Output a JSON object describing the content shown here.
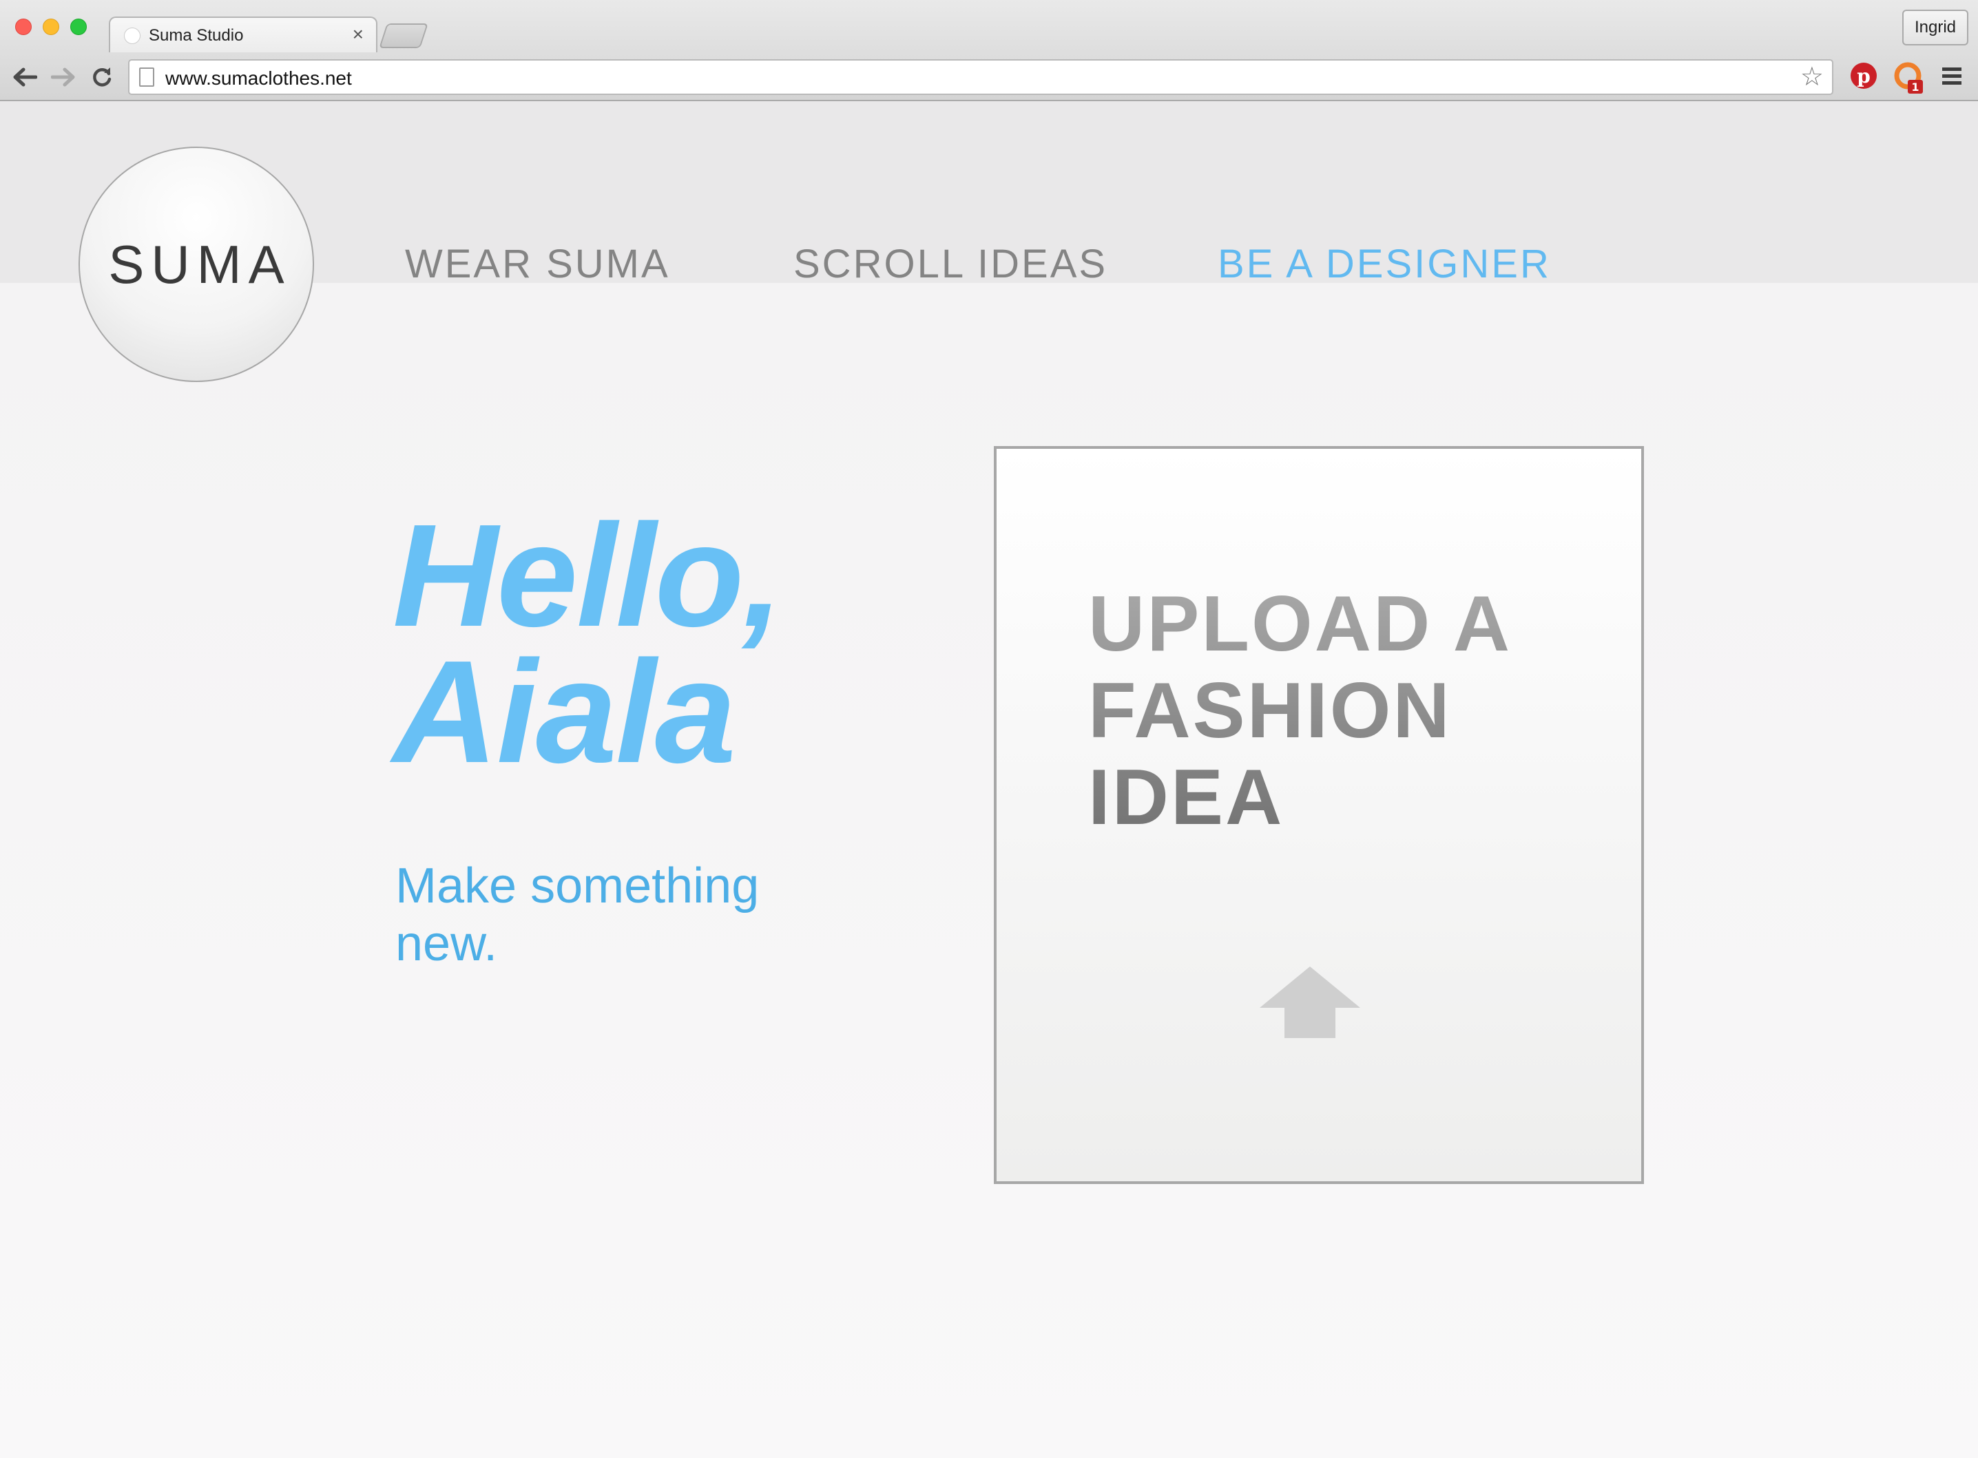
{
  "browser": {
    "tab_title": "Suma Studio",
    "tab_close": "×",
    "profile_name": "Ingrid",
    "url": "www.sumaclothes.net",
    "extension_badge": "1",
    "icons": [
      "back-icon",
      "forward-icon",
      "reload-icon",
      "page-icon",
      "star-icon",
      "pinterest-icon",
      "extension-icon",
      "menu-icon"
    ]
  },
  "site": {
    "logo_text": "SUMA",
    "nav": [
      {
        "label": "WEAR SUMA"
      },
      {
        "label": "SCROLL IDEAS"
      },
      {
        "label": "BE A DESIGNER",
        "active": true
      }
    ],
    "greeting_line1": "Hello,",
    "greeting_line2": "Aiala",
    "tagline": "Make something new.",
    "upload": {
      "line1": "UPLOAD A",
      "line2": "FASHION",
      "line3": "IDEA",
      "icon": "upload-arrow-icon"
    }
  },
  "colors": {
    "accent": "#61b9f0",
    "nav_grey": "#848484",
    "logo_text": "#3a3a3a"
  }
}
